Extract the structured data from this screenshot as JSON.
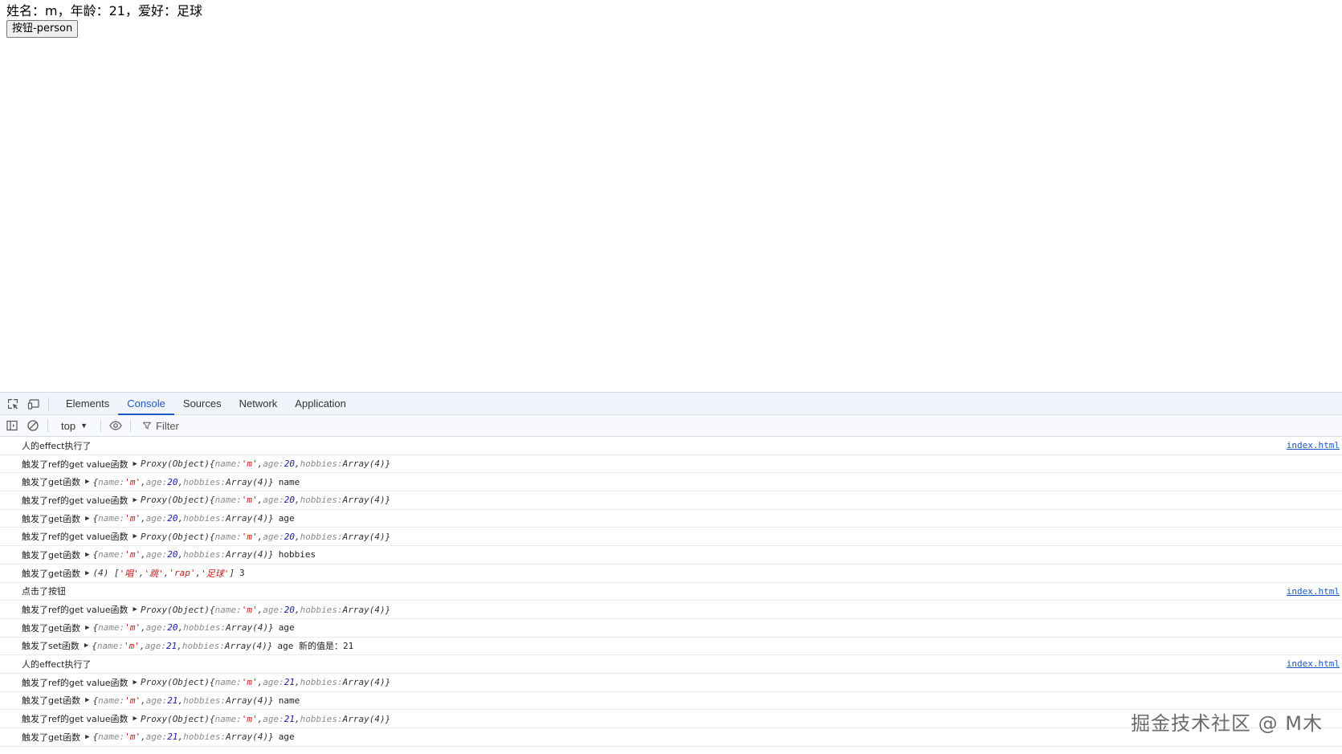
{
  "page": {
    "person_line": "姓名：m，年龄：21，爱好：足球",
    "button_label": "按钮-person"
  },
  "devtools": {
    "tabs": [
      "Elements",
      "Console",
      "Sources",
      "Network",
      "Application"
    ],
    "active_tab": "Console",
    "context": "top",
    "filter_placeholder": "Filter"
  },
  "console": {
    "rows": [
      {
        "type": "text",
        "msg": "人的effect执行了",
        "source": "index.html"
      },
      {
        "type": "proxy",
        "msg": "触发了ref的get value函数",
        "prefix": "Proxy(Object)",
        "name": "'m'",
        "age": "20"
      },
      {
        "type": "obj",
        "msg": "触发了get函数",
        "name": "'m'",
        "age": "20",
        "suffix": "name"
      },
      {
        "type": "proxy",
        "msg": "触发了ref的get value函数",
        "prefix": "Proxy(Object)",
        "name": "'m'",
        "age": "20"
      },
      {
        "type": "obj",
        "msg": "触发了get函数",
        "name": "'m'",
        "age": "20",
        "suffix": "age"
      },
      {
        "type": "proxy",
        "msg": "触发了ref的get value函数",
        "prefix": "Proxy(Object)",
        "name": "'m'",
        "age": "20"
      },
      {
        "type": "obj",
        "msg": "触发了get函数",
        "name": "'m'",
        "age": "20",
        "suffix": "hobbies"
      },
      {
        "type": "array",
        "msg": "触发了get函数",
        "len": "(4)",
        "items": [
          "'唱'",
          "'跳'",
          "'rap'",
          "'足球'"
        ],
        "suffix": "3"
      },
      {
        "type": "text",
        "msg": "点击了按钮",
        "source": "index.html"
      },
      {
        "type": "proxy",
        "msg": "触发了ref的get value函数",
        "prefix": "Proxy(Object)",
        "name": "'m'",
        "age": "20"
      },
      {
        "type": "obj",
        "msg": "触发了get函数",
        "name": "'m'",
        "age": "20",
        "suffix": "age"
      },
      {
        "type": "obj",
        "msg": "触发了set函数",
        "name": "'m'",
        "age": "21",
        "suffix": "age 新的值是：21"
      },
      {
        "type": "text",
        "msg": "人的effect执行了",
        "source": "index.html"
      },
      {
        "type": "proxy",
        "msg": "触发了ref的get value函数",
        "prefix": "Proxy(Object)",
        "name": "'m'",
        "age": "21"
      },
      {
        "type": "obj",
        "msg": "触发了get函数",
        "name": "'m'",
        "age": "21",
        "suffix": "name"
      },
      {
        "type": "proxy",
        "msg": "触发了ref的get value函数",
        "prefix": "Proxy(Object)",
        "name": "'m'",
        "age": "21"
      },
      {
        "type": "obj",
        "msg": "触发了get函数",
        "name": "'m'",
        "age": "21",
        "suffix": "age"
      }
    ],
    "key_name": "name",
    "key_age": "age",
    "key_hobbies": "hobbies",
    "hobbies_value": "Array(4)"
  },
  "watermark": "掘金技术社区 @ M木"
}
